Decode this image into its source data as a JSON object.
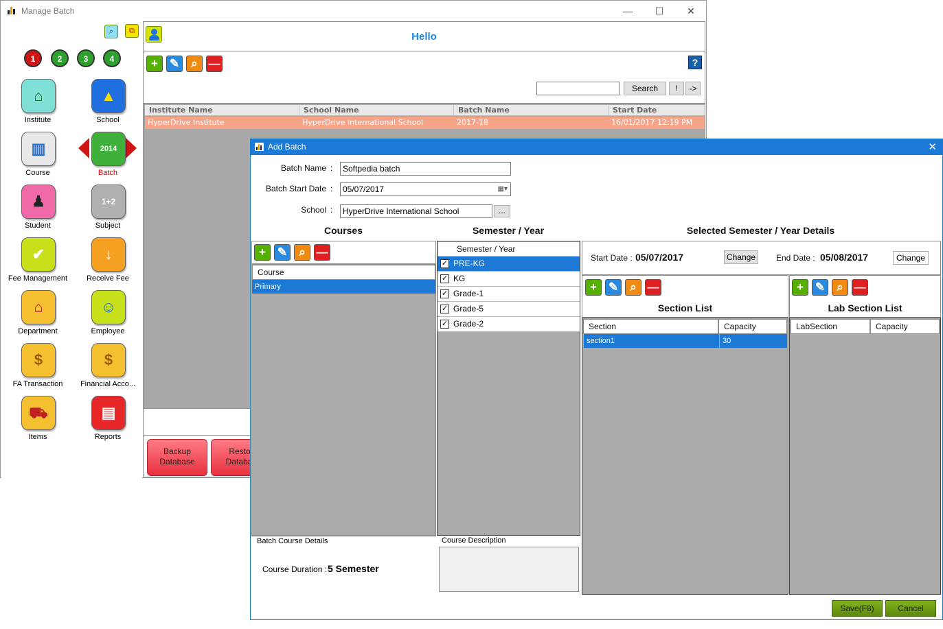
{
  "main_window": {
    "title": "Manage Batch",
    "controls": {
      "minimize": "—",
      "maximize": "☐",
      "close": "✕"
    }
  },
  "sidebar": {
    "tiny_buttons": [
      "search-icon",
      "window-switch-icon"
    ],
    "steps": [
      "1",
      "2",
      "3",
      "4"
    ],
    "items": [
      {
        "label": "Institute",
        "icon": "institute-icon",
        "glyph": "⌂",
        "color": "#7ee0d8"
      },
      {
        "label": "School",
        "icon": "school-icon",
        "glyph": "▲",
        "color": "#1f6fe0"
      },
      {
        "label": "Course",
        "icon": "course-icon",
        "glyph": "▥",
        "color": "#e8e8e8"
      },
      {
        "label": "Batch",
        "icon": "batch-icon",
        "glyph": "2014",
        "color": "#3fb03a"
      },
      {
        "label": "Student",
        "icon": "student-icon",
        "glyph": "♟",
        "color": "#f06aa8"
      },
      {
        "label": "Subject",
        "icon": "subject-icon",
        "glyph": "1+2",
        "color": "#b0b0b0"
      },
      {
        "label": "Fee Management",
        "icon": "fee-management-icon",
        "glyph": "✔",
        "color": "#c8e01a"
      },
      {
        "label": "Receive Fee",
        "icon": "receive-fee-icon",
        "glyph": "↓",
        "color": "#f5a020"
      },
      {
        "label": "Department",
        "icon": "department-icon",
        "glyph": "⌂",
        "color": "#f5c030"
      },
      {
        "label": "Employee",
        "icon": "employee-icon",
        "glyph": "☺",
        "color": "#c8e01a"
      },
      {
        "label": "FA Transaction",
        "icon": "fa-transaction-icon",
        "glyph": "$",
        "color": "#f5c030"
      },
      {
        "label": "Financial Acco...",
        "icon": "financial-accounts-icon",
        "glyph": "$",
        "color": "#f5c030"
      },
      {
        "label": "Items",
        "icon": "items-icon",
        "glyph": "⛟",
        "color": "#f5c030"
      },
      {
        "label": "Reports",
        "icon": "reports-icon",
        "glyph": "▤",
        "color": "#e82828"
      }
    ],
    "active_item": "Batch"
  },
  "header": {
    "greeting": "Hello"
  },
  "toolbar": {
    "add": "+",
    "edit": "✎",
    "search": "⌕",
    "delete": "—",
    "help": "?",
    "search_value": "",
    "search_label": "Search",
    "bang_label": "!",
    "next_label": "->"
  },
  "batch_grid": {
    "columns": [
      "Institute Name",
      "School Name",
      "Batch Name",
      "Start Date"
    ],
    "rows": [
      [
        "HyperDrive Institute",
        "HyperDrive International School",
        "2017-18",
        "16/01/2017 12:19 PM"
      ]
    ]
  },
  "footer_buttons": {
    "backup": [
      "Backup",
      "Database"
    ],
    "restore": [
      "Restor",
      "Databas"
    ]
  },
  "dialog": {
    "title": "Add Batch",
    "close": "✕",
    "batch_name_label": "Batch Name",
    "batch_name_value": "Softpedia batch",
    "start_date_label": "Batch Start Date",
    "start_date_value": "05/07/2017",
    "school_label": "School",
    "school_value": "HyperDrive International School",
    "browse_label": "...",
    "colon": ":",
    "courses_header": "Courses",
    "semester_header": "Semester / Year",
    "details_header": "Selected Semester / Year Details",
    "course_column": "Course",
    "courses": [
      "Primary"
    ],
    "semester_column": "Semester / Year",
    "semesters": [
      {
        "name": "PRE-KG",
        "checked": true,
        "selected": true
      },
      {
        "name": "KG",
        "checked": true,
        "selected": false
      },
      {
        "name": "Grade-1",
        "checked": true,
        "selected": false
      },
      {
        "name": "Grade-5",
        "checked": true,
        "selected": false
      },
      {
        "name": "Grade-2",
        "checked": true,
        "selected": false
      }
    ],
    "check_mark": "✓",
    "start_date_lbl": "Start Date :",
    "start_date_val": "05/07/2017",
    "end_date_lbl": "End Date :",
    "end_date_val": "05/08/2017",
    "change_label": "Change",
    "section_list_title": "Section List",
    "section_columns": [
      "Section",
      "Capacity"
    ],
    "sections": [
      [
        "section1",
        "30"
      ]
    ],
    "lab_section_title": "Lab Section List",
    "lab_columns": [
      "LabSection",
      "Capacity"
    ],
    "batch_course_details_label": "Batch  Course Details",
    "course_duration_label": "Course Duration :",
    "course_duration_value": "5 Semester",
    "course_description_label": "Course Description",
    "save_label": "Save(F8)",
    "cancel_label": "Cancel"
  }
}
